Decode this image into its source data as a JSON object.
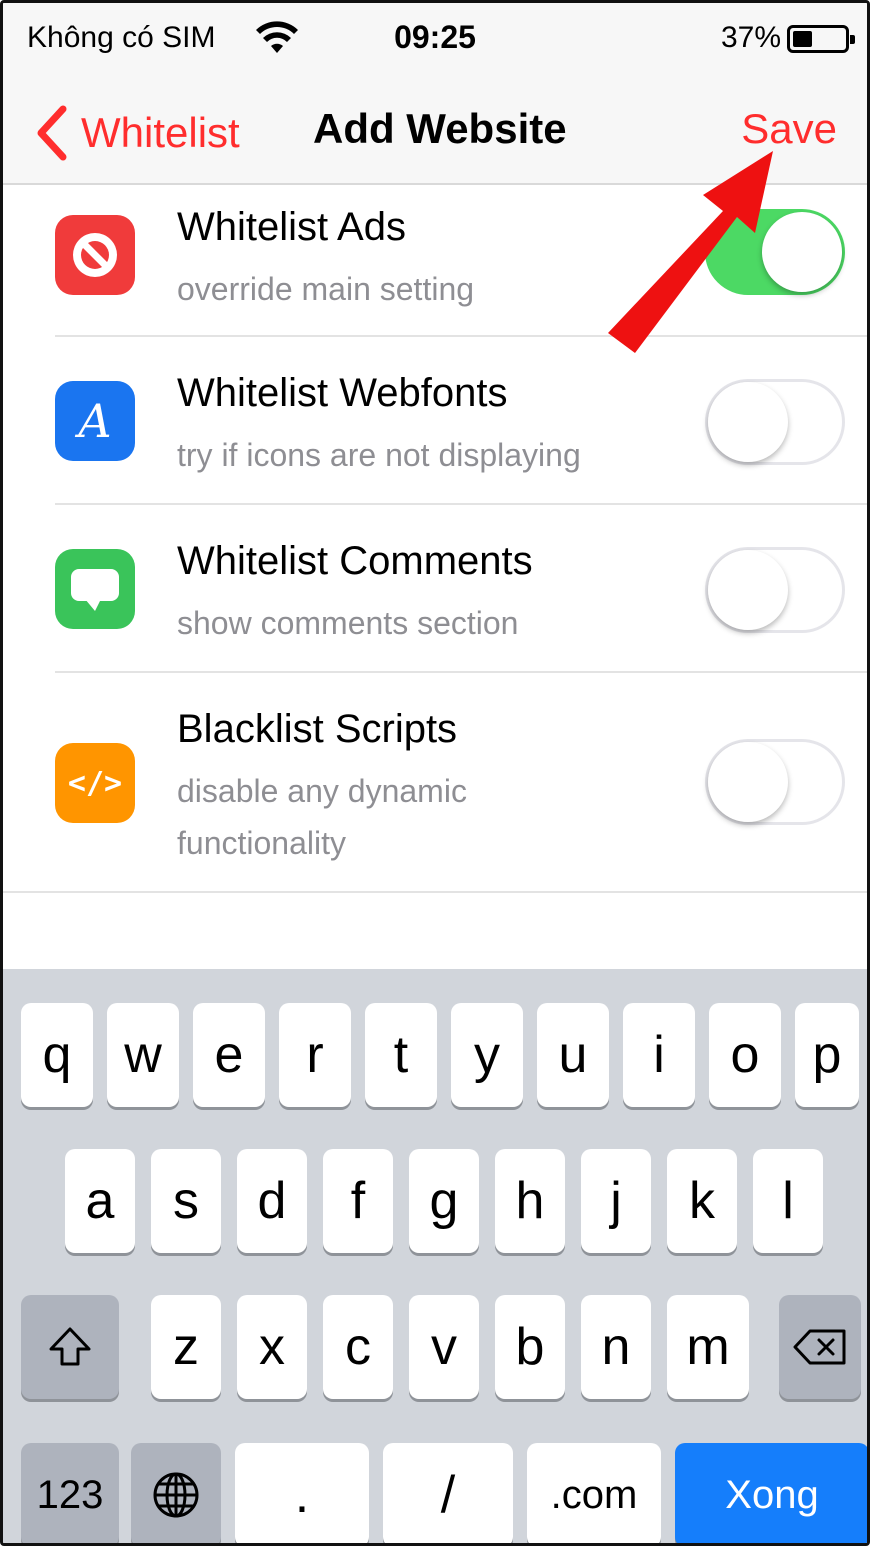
{
  "status_bar": {
    "carrier": "Không có SIM",
    "time": "09:25",
    "battery_percent": "37%",
    "battery_level": 0.37,
    "wifi_icon": "wifi-icon"
  },
  "nav": {
    "back_label": "Whitelist",
    "title": "Add Website",
    "save_label": "Save"
  },
  "colors": {
    "accent_red": "#ff2d2d",
    "toggle_on": "#4cd964",
    "keyboard_bg": "#d1d5db",
    "done_key": "#157efb"
  },
  "settings": [
    {
      "label": "Whitelist Ads",
      "sub": "override main setting",
      "icon": "block-icon",
      "icon_color": "#f03b3b",
      "on": true
    },
    {
      "label": "Whitelist Webfonts",
      "sub": "try if icons are not displaying",
      "icon": "font-icon",
      "icon_color": "#1a75f0",
      "on": false
    },
    {
      "label": "Whitelist Comments",
      "sub": "show comments section",
      "icon": "comment-icon",
      "icon_color": "#3ac45a",
      "on": false
    },
    {
      "label": "Blacklist Scripts",
      "sub": "disable any dynamic functionality",
      "icon": "code-icon",
      "icon_color": "#ff9500",
      "on": false
    }
  ],
  "keyboard": {
    "row1": [
      "q",
      "w",
      "e",
      "r",
      "t",
      "y",
      "u",
      "i",
      "o",
      "p"
    ],
    "row2": [
      "a",
      "s",
      "d",
      "f",
      "g",
      "h",
      "j",
      "k",
      "l"
    ],
    "row3": [
      "z",
      "x",
      "c",
      "v",
      "b",
      "n",
      "m"
    ],
    "numbers_key": "123",
    "dot_key": ".",
    "slash_key": "/",
    "dotcom_key": ".com",
    "done_key": "Xong"
  }
}
